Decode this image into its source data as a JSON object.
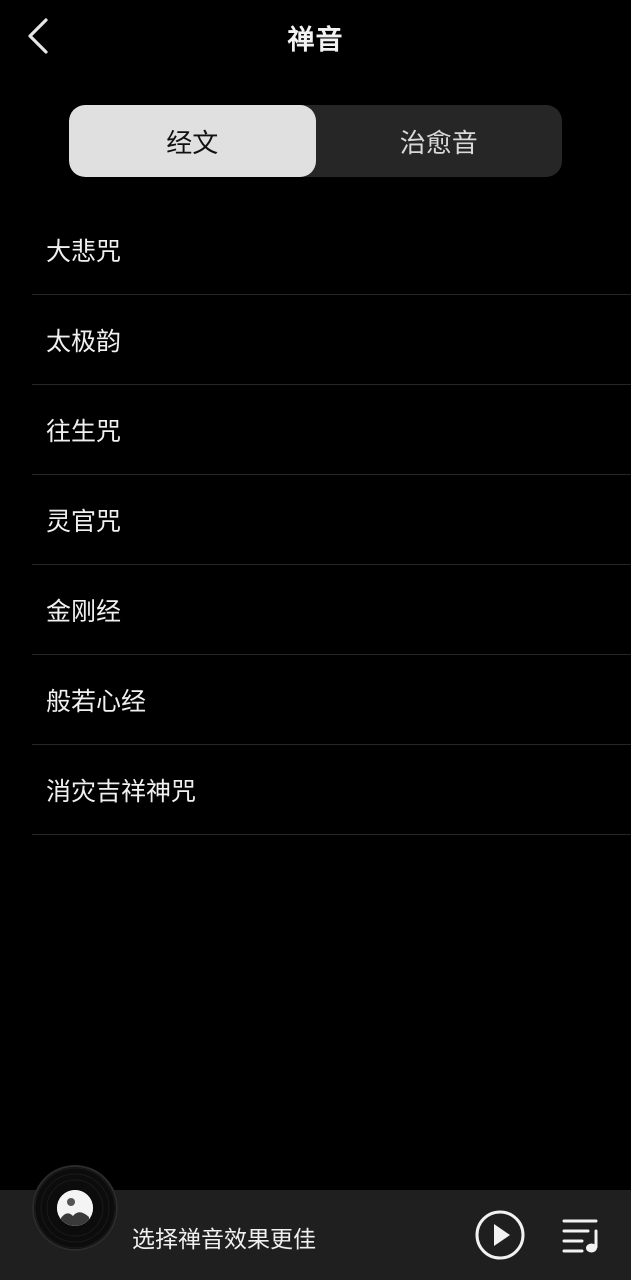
{
  "header": {
    "title": "禅音",
    "back_icon": "chevron-left-icon"
  },
  "tabs": [
    {
      "label": "经文",
      "active": true
    },
    {
      "label": "治愈音",
      "active": false
    }
  ],
  "list": {
    "items": [
      {
        "label": "大悲咒"
      },
      {
        "label": "太极韵"
      },
      {
        "label": "往生咒"
      },
      {
        "label": "灵官咒"
      },
      {
        "label": "金刚经"
      },
      {
        "label": "般若心经"
      },
      {
        "label": "消灾吉祥神咒"
      }
    ]
  },
  "player": {
    "status_text": "选择禅音效果更佳",
    "disc_icon": "vinyl-disc-icon",
    "play_icon": "play-circle-icon",
    "playlist_icon": "playlist-music-icon"
  },
  "colors": {
    "background": "#000000",
    "segment_bg": "#262626",
    "segment_active_bg": "#e0e0e0",
    "player_bar_bg": "#1f1f1f",
    "divider": "#262626"
  }
}
